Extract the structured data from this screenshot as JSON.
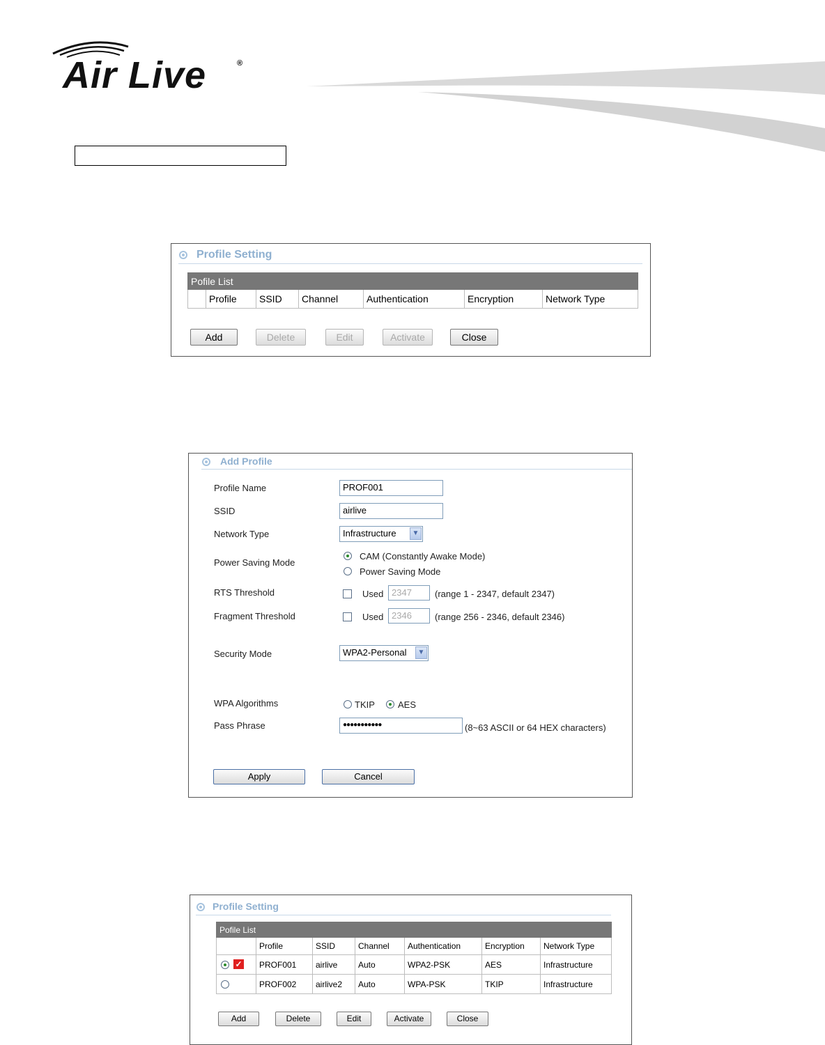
{
  "header": {
    "logo_text": "Air Live",
    "logo_mark": "®"
  },
  "profile_setting_empty": {
    "title": "Profile Setting",
    "list_caption": "Pofile List",
    "columns": [
      "Profile",
      "SSID",
      "Channel",
      "Authentication",
      "Encryption",
      "Network Type"
    ],
    "buttons": {
      "add": "Add",
      "delete": "Delete",
      "edit": "Edit",
      "activate": "Activate",
      "close": "Close"
    }
  },
  "add_profile": {
    "title": "Add Profile",
    "profile_name_label": "Profile Name",
    "profile_name_value": "PROF001",
    "ssid_label": "SSID",
    "ssid_value": "airlive",
    "network_type_label": "Network Type",
    "network_type_value": "Infrastructure",
    "power_saving_label": "Power Saving Mode",
    "power_saving_options": [
      "CAM (Constantly Awake Mode)",
      "Power Saving Mode"
    ],
    "power_saving_selected": "CAM (Constantly Awake Mode)",
    "rts_label": "RTS Threshold",
    "rts_used_label": "Used",
    "rts_value": "2347",
    "rts_range": "(range 1 - 2347, default 2347)",
    "frag_label": "Fragment Threshold",
    "frag_used_label": "Used",
    "frag_value": "2346",
    "frag_range": "(range 256 - 2346, default 2346)",
    "security_mode_label": "Security Mode",
    "security_mode_value": "WPA2-Personal",
    "wpa_algorithms_label": "WPA Algorithms",
    "wpa_tkip": "TKIP",
    "wpa_aes": "AES",
    "wpa_selected": "AES",
    "pass_phrase_label": "Pass Phrase",
    "pass_phrase_value": "●●●●●●●●●●●",
    "pass_phrase_hint": "(8~63 ASCII or 64 HEX characters)",
    "apply_button": "Apply",
    "cancel_button": "Cancel"
  },
  "profile_setting_filled": {
    "title": "Profile Setting",
    "list_caption": "Pofile List",
    "columns": [
      "Profile",
      "SSID",
      "Channel",
      "Authentication",
      "Encryption",
      "Network Type"
    ],
    "rows": [
      {
        "selected": true,
        "active": true,
        "profile": "PROF001",
        "ssid": "airlive",
        "channel": "Auto",
        "authentication": "WPA2-PSK",
        "encryption": "AES",
        "network_type": "Infrastructure"
      },
      {
        "selected": false,
        "active": false,
        "profile": "PROF002",
        "ssid": "airlive2",
        "channel": "Auto",
        "authentication": "WPA-PSK",
        "encryption": "TKIP",
        "network_type": "Infrastructure"
      }
    ],
    "buttons": {
      "add": "Add",
      "delete": "Delete",
      "edit": "Edit",
      "activate": "Activate",
      "close": "Close"
    }
  }
}
